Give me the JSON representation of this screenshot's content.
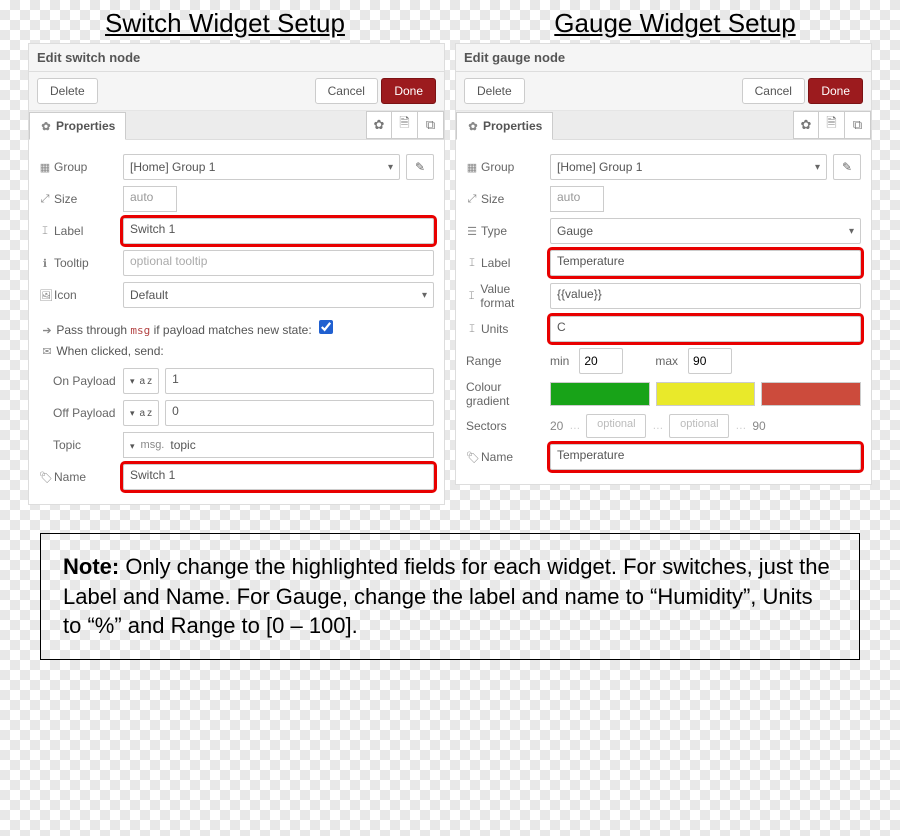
{
  "titles": {
    "left": "Switch Widget Setup",
    "right": "Gauge Widget Setup"
  },
  "switch": {
    "header": "Edit switch node",
    "delete": "Delete",
    "cancel": "Cancel",
    "done": "Done",
    "properties_tab": "Properties",
    "group_label": "Group",
    "group_value": "[Home] Group 1",
    "size_label": "Size",
    "size_value": "auto",
    "label_label": "Label",
    "label_value": "Switch 1",
    "tooltip_label": "Tooltip",
    "tooltip_ph": "optional tooltip",
    "icon_label": "Icon",
    "icon_value": "Default",
    "passthrough_pre": "Pass through ",
    "passthrough_msg": "msg",
    "passthrough_post": " if payload matches new state:",
    "when_clicked": "When clicked, send:",
    "on_label": "On Payload",
    "on_value": "1",
    "off_label": "Off Payload",
    "off_value": "0",
    "topic_label": "Topic",
    "topic_msg": "msg.",
    "topic_value": "topic",
    "name_label": "Name",
    "name_value": "Switch 1"
  },
  "gauge": {
    "header": "Edit gauge node",
    "delete": "Delete",
    "cancel": "Cancel",
    "done": "Done",
    "properties_tab": "Properties",
    "group_label": "Group",
    "group_value": "[Home] Group 1",
    "size_label": "Size",
    "size_value": "auto",
    "type_label": "Type",
    "type_value": "Gauge",
    "label_label": "Label",
    "label_value": "Temperature",
    "valfmt_label": "Value format",
    "valfmt_value": "{{value}}",
    "units_label": "Units",
    "units_value": "C",
    "range_label": "Range",
    "range_min_l": "min",
    "range_min_v": "20",
    "range_max_l": "max",
    "range_max_v": "90",
    "colour_label": "Colour gradient",
    "colours": [
      "#18a318",
      "#e9e92a",
      "#cc4b3c"
    ],
    "sectors_label": "Sectors",
    "sectors_start": "20",
    "sectors_opt": "optional",
    "sectors_end": "90",
    "name_label": "Name",
    "name_value": "Temperature"
  },
  "note": {
    "bold": "Note:",
    "text": " Only change the highlighted fields for each widget. For switches, just the Label and Name. For Gauge, change the label and name to “Humidity”, Units to “%” and Range to [0 – 100]."
  }
}
